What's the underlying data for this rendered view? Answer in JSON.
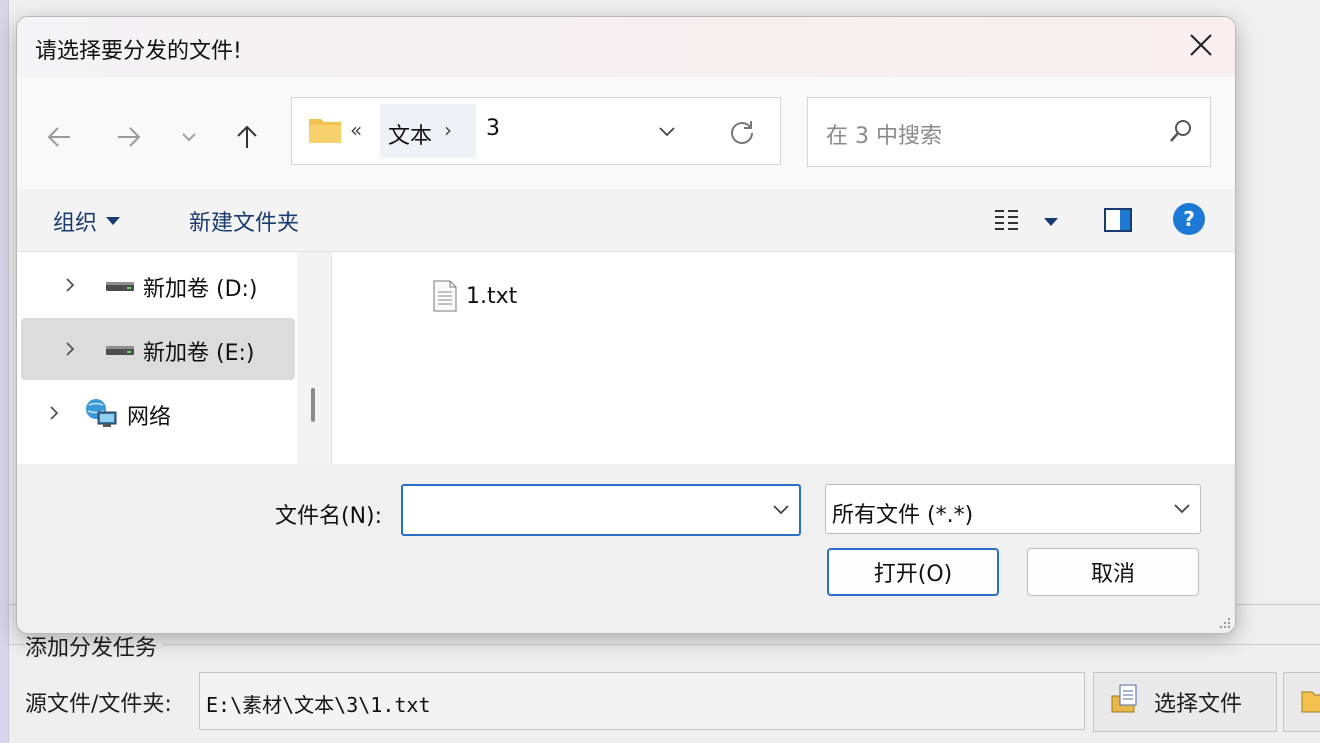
{
  "background_app": {
    "group_title": "添加分发任务",
    "source_label": "源文件/文件夹:",
    "source_value": "E:\\素材\\文本\\3\\1.txt",
    "choose_file_label": "选择文件"
  },
  "dialog": {
    "title": "请选择要分发的文件!",
    "address": {
      "overflow_glyph": "«",
      "segment_parent": "文本",
      "separator": "›",
      "segment_current": "3"
    },
    "search": {
      "placeholder": "在 3 中搜索"
    },
    "toolbar": {
      "organize_label": "组织",
      "new_folder_label": "新建文件夹",
      "help_glyph": "?"
    },
    "nav_tree": [
      {
        "label": "新加卷 (D:)",
        "icon": "drive-icon",
        "selected": false
      },
      {
        "label": "新加卷 (E:)",
        "icon": "drive-icon",
        "selected": true
      },
      {
        "label": "网络",
        "icon": "network-icon",
        "selected": false
      }
    ],
    "files": [
      {
        "name": "1.txt",
        "icon": "text-file-icon"
      }
    ],
    "filename_label": "文件名(N):",
    "filename_value": "",
    "filetype_value": "所有文件 (*.*)",
    "open_label": "打开(O)",
    "cancel_label": "取消"
  },
  "colors": {
    "accent": "#2a6fc2",
    "help": "#1c79d6",
    "folder": "#f2c14e",
    "selected_row": "#dcdcdc"
  }
}
